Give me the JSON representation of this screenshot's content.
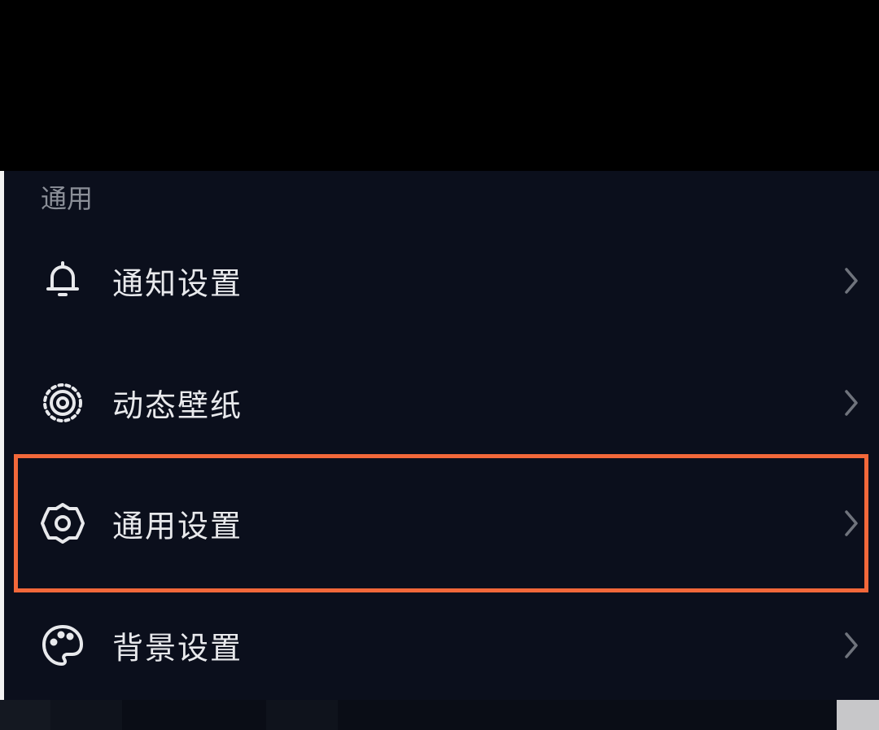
{
  "section": {
    "title": "通用"
  },
  "menu": {
    "items": [
      {
        "label": "通知设置",
        "icon": "bell-icon"
      },
      {
        "label": "动态壁纸",
        "icon": "wallpaper-icon"
      },
      {
        "label": "通用设置",
        "icon": "gear-icon"
      },
      {
        "label": "背景设置",
        "icon": "palette-icon"
      }
    ]
  },
  "colors": {
    "background": "#0b0f1c",
    "text": "#e8e9ec",
    "section_text": "#8b8f98",
    "highlight": "#f2683a",
    "chevron": "#6f737c"
  }
}
